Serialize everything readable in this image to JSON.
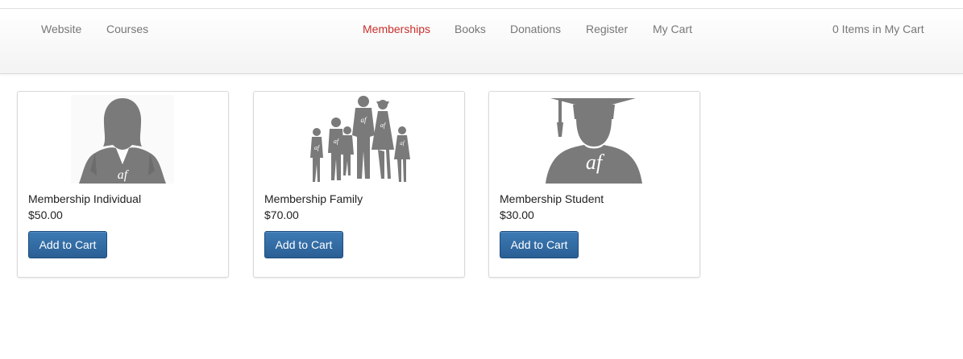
{
  "nav": {
    "left_links": [
      "Website",
      "Courses"
    ],
    "center_links": [
      "Memberships",
      "Books",
      "Donations",
      "Register",
      "My Cart"
    ],
    "active": "Memberships",
    "cart_status": "0 Items in My Cart"
  },
  "products": [
    {
      "name": "Membership Individual",
      "price": "$50.00",
      "button": "Add to Cart",
      "icon": "businesswoman-silhouette-icon",
      "logo": "af"
    },
    {
      "name": "Membership Family",
      "price": "$70.00",
      "button": "Add to Cart",
      "icon": "family-silhouette-icon",
      "logo": "af"
    },
    {
      "name": "Membership Student",
      "price": "$30.00",
      "button": "Add to Cart",
      "icon": "graduate-silhouette-icon",
      "logo": "af"
    }
  ],
  "colors": {
    "active_link": "#c9302c",
    "button": "#2a5f94",
    "silhouette": "#7a7a7a"
  }
}
